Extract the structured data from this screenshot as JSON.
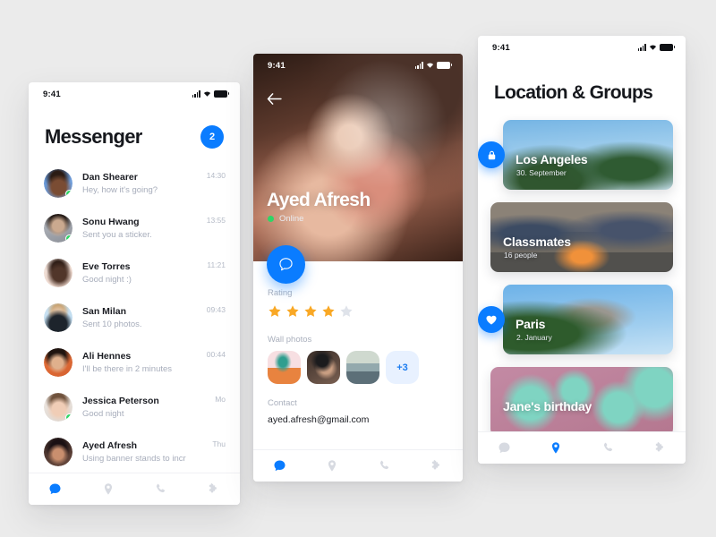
{
  "background_color": "#ebebeb",
  "accent_color": "#0a7cff",
  "online_color": "#2fd566",
  "star_color": "#f9a825",
  "status_bar": {
    "time": "9:41",
    "signal_icon": "signal-bars-icon",
    "wifi_icon": "wifi-icon",
    "battery_icon": "battery-icon"
  },
  "messenger": {
    "title": "Messenger",
    "unread_badge": "2",
    "conversations": [
      {
        "name": "Dan Shearer",
        "preview": "Hey, how it's going?",
        "time": "14:30",
        "online": true
      },
      {
        "name": "Sonu Hwang",
        "preview": "Sent you a sticker.",
        "time": "13:55",
        "online": true
      },
      {
        "name": "Eve Torres",
        "preview": "Good night :)",
        "time": "11:21",
        "online": false
      },
      {
        "name": "San Milan",
        "preview": "Sent 10 photos.",
        "time": "09:43",
        "online": false
      },
      {
        "name": "Ali Hennes",
        "preview": "I'll be there in 2 minutes",
        "time": "00:44",
        "online": false
      },
      {
        "name": "Jessica Peterson",
        "preview": "Good night",
        "time": "Mo",
        "online": true
      },
      {
        "name": "Ayed Afresh",
        "preview": "Using banner stands to incr",
        "time": "Thu",
        "online": false
      }
    ]
  },
  "profile": {
    "back_icon": "back-arrow-icon",
    "name": "Ayed Afresh",
    "status": "Online",
    "message_button_icon": "chat-bubble-icon",
    "rating_label": "Rating",
    "rating_value": 4,
    "rating_max": 5,
    "wall_photos_label": "Wall photos",
    "wall_photos_more": "+3",
    "contact_label": "Contact",
    "contact_email": "ayed.afresh@gmail.com"
  },
  "groups": {
    "title": "Location & Groups",
    "cards": [
      {
        "title": "Los Angeles",
        "subtitle": "30. September",
        "badge_icon": "lock-icon",
        "has_badge": true,
        "inset": true
      },
      {
        "title": "Classmates",
        "subtitle": "16 people",
        "badge_icon": "",
        "has_badge": false,
        "inset": false
      },
      {
        "title": "Paris",
        "subtitle": "2. January",
        "badge_icon": "heart-icon",
        "has_badge": true,
        "inset": true
      },
      {
        "title": "Jane's birthday",
        "subtitle": "",
        "badge_icon": "",
        "has_badge": false,
        "inset": false
      }
    ]
  },
  "tabbar": {
    "tabs": [
      {
        "name": "chat",
        "icon": "chat-bubble-icon"
      },
      {
        "name": "location",
        "icon": "location-pin-icon"
      },
      {
        "name": "calls",
        "icon": "phone-icon"
      },
      {
        "name": "more",
        "icon": "puzzle-icon"
      }
    ],
    "active_messenger": "chat",
    "active_profile": "chat",
    "active_groups": "location"
  }
}
